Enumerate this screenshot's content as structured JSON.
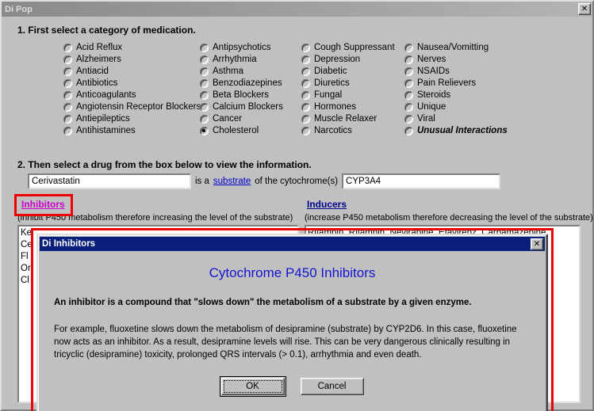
{
  "window": {
    "title": "Di Pop",
    "close_label": "✕"
  },
  "step1": {
    "label": "1. First select a category of medication.",
    "columns": [
      {
        "items": [
          {
            "label": "Acid Reflux",
            "checked": false
          },
          {
            "label": "Alzheimers",
            "checked": false
          },
          {
            "label": "Antiacid",
            "checked": false
          },
          {
            "label": "Antibiotics",
            "checked": false
          },
          {
            "label": "Anticoagulants",
            "checked": false
          },
          {
            "label": "Angiotensin Receptor Blockers",
            "checked": false
          },
          {
            "label": "Antiepileptics",
            "checked": false
          },
          {
            "label": "Antihistamines",
            "checked": false
          }
        ]
      },
      {
        "items": [
          {
            "label": "Antipsychotics",
            "checked": false
          },
          {
            "label": "Arrhythmia",
            "checked": false
          },
          {
            "label": "Asthma",
            "checked": false
          },
          {
            "label": "Benzodiazepines",
            "checked": false
          },
          {
            "label": "Beta Blockers",
            "checked": false
          },
          {
            "label": "Calcium Blockers",
            "checked": false
          },
          {
            "label": "Cancer",
            "checked": false
          },
          {
            "label": "Cholesterol",
            "checked": true
          }
        ]
      },
      {
        "items": [
          {
            "label": "Cough Suppressant",
            "checked": false
          },
          {
            "label": "Depression",
            "checked": false
          },
          {
            "label": "Diabetic",
            "checked": false
          },
          {
            "label": "Diuretics",
            "checked": false
          },
          {
            "label": "Fungal",
            "checked": false
          },
          {
            "label": "Hormones",
            "checked": false
          },
          {
            "label": "Muscle Relaxer",
            "checked": false
          },
          {
            "label": "Narcotics",
            "checked": false
          }
        ]
      },
      {
        "items": [
          {
            "label": "Nausea/Vomitting",
            "checked": false
          },
          {
            "label": "Nerves",
            "checked": false
          },
          {
            "label": "NSAIDs",
            "checked": false
          },
          {
            "label": "Pain Relievers",
            "checked": false
          },
          {
            "label": "Steroids",
            "checked": false
          },
          {
            "label": "Unique",
            "checked": false
          },
          {
            "label": "Viral",
            "checked": false
          },
          {
            "label": "Unusual Interactions",
            "checked": false,
            "emphasis": true
          }
        ]
      }
    ]
  },
  "step2": {
    "label": "2. Then select a drug from the box below to view the information.",
    "drug_value": "Cerivastatin",
    "drug_placeholder": "",
    "text_before_link": "is a",
    "link_label": "substrate",
    "text_after_link": "of the cytochrome(s)",
    "cytochrome_value": "CYP3A4",
    "cytochrome_placeholder": ""
  },
  "inhibitors": {
    "heading": "Inhibitors",
    "subtitle": "(inhibit P450 metabolism therefore increasing the level of the substrate)",
    "items": [
      "Ke",
      "Ce",
      "Fl",
      "Or",
      "Cl"
    ]
  },
  "inducers": {
    "heading": "Inducers",
    "subtitle": "(increase P450 metabolism therefore decreasing the level of the substrate)",
    "items": [
      "Rifampin, Rifampin, Nevirapine, Efavirenz, Carbamazepine"
    ]
  },
  "dialog": {
    "title": "Di Inhibitors",
    "close_label": "✕",
    "heading": "Cytochrome P450 Inhibitors",
    "bold_line": "An inhibitor is a compound that \"slows down\" the metabolism of a substrate by a given enzyme.",
    "paragraph": "For example, fluoxetine slows down the metabolism of desipramine (substrate) by CYP2D6.  In this case, fluoxetine now acts as an inhibitor.  As a result, desipramine levels will rise.  This can be very dangerous clinically resulting in tricyclic (desipramine) toxicity, prolonged QRS intervals (> 0.1), arrhythmia and even death.",
    "ok_label": "OK",
    "cancel_label": "Cancel"
  },
  "colors": {
    "inhibitor_link": "#cc00cc",
    "inducer_link": "#00008b",
    "annotation": "#ee0000",
    "dialog_title_bg": "#0a1f7a",
    "heading_blue": "#1414d2"
  }
}
